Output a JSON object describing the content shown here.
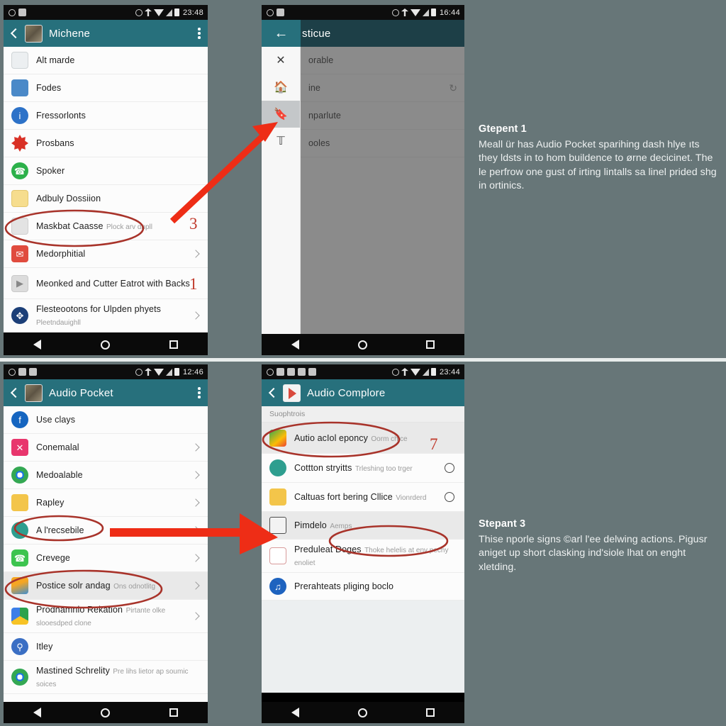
{
  "meta": {
    "background_color": "#677678",
    "accent_teal": "#27707c",
    "annotation_red": "#d6281e"
  },
  "panels": {
    "top_left": {
      "name": "top-left-phone",
      "statusbar": {
        "clock": "23:48",
        "icons": [
          "alarm-icon",
          "sd-card-icon",
          "location-icon",
          "nfc-icon",
          "wifi-icon",
          "signal-icon",
          "battery-icon"
        ]
      },
      "toolbar": {
        "title": "Michene",
        "back": "back-arrow",
        "overflow": "more-options"
      },
      "items": [
        {
          "title": "Alt marde",
          "sub": "",
          "icon": "calendar-icon",
          "trailing": ""
        },
        {
          "title": "Fodes",
          "sub": "",
          "icon": "contacts-icon",
          "trailing": ""
        },
        {
          "title": "Fressorlonts",
          "sub": "",
          "icon": "info-icon",
          "trailing": ""
        },
        {
          "title": "Prosbans",
          "sub": "",
          "icon": "alert-icon",
          "trailing": ""
        },
        {
          "title": "Spoker",
          "sub": "",
          "icon": "phone-icon",
          "trailing": ""
        },
        {
          "title": "Adbuly Dossiion",
          "sub": "",
          "icon": "person-icon",
          "trailing": ""
        },
        {
          "title": "Maskbat Caasse",
          "sub": "Plock arv dnpll",
          "icon": "media-icon",
          "trailing": ""
        },
        {
          "title": "Medorphitial",
          "sub": "",
          "icon": "mail-icon",
          "trailing": "chevron"
        },
        {
          "title": "Meonked and Cutter Eatrot with Backs",
          "sub": "",
          "icon": "video-icon",
          "trailing": ""
        },
        {
          "title": "Flesteootons for Ulpden phyets",
          "sub": "Pleetndauighll",
          "icon": "bluetooth-icon",
          "trailing": "chevron"
        }
      ]
    },
    "top_right": {
      "name": "top-right-phone",
      "statusbar": {
        "clock": "16:44"
      },
      "toolbar": {
        "title": "sticue"
      },
      "rail": [
        "close-icon",
        "home-icon",
        "bookmark-icon",
        "text-icon"
      ],
      "items": [
        {
          "title": "orable",
          "trailing": ""
        },
        {
          "title": "ine",
          "trailing": "refresh"
        },
        {
          "title": "nparlute",
          "trailing": ""
        },
        {
          "title": "ooles",
          "trailing": ""
        }
      ]
    },
    "bottom_left": {
      "name": "bottom-left-phone",
      "statusbar": {
        "clock": "12:46"
      },
      "toolbar": {
        "title": "Audio Pocket"
      },
      "items": [
        {
          "title": "Use clays",
          "sub": "",
          "icon": "facebook-icon",
          "trailing": ""
        },
        {
          "title": "Conemalal",
          "sub": "",
          "icon": "close-pink-icon",
          "trailing": "chevron"
        },
        {
          "title": "Medoalable",
          "sub": "",
          "icon": "chrome-icon",
          "trailing": "chevron"
        },
        {
          "title": "Rapley",
          "sub": "",
          "icon": "notes-icon",
          "trailing": "chevron"
        },
        {
          "title": "A l'recsebile",
          "sub": "",
          "icon": "accessibility-icon",
          "trailing": "chevron"
        },
        {
          "title": "Crevege",
          "sub": "",
          "icon": "phone-green-icon",
          "trailing": "chevron"
        },
        {
          "title": "Postice solr andag",
          "sub": "Ons odnotlitg",
          "icon": "photos-icon",
          "trailing": "chevron"
        },
        {
          "title": "Prodnamnlo Rekation",
          "sub": "Pirtante olke slooesdped clone",
          "icon": "drive-icon",
          "trailing": "chevron"
        },
        {
          "title": "Itley",
          "sub": "",
          "icon": "search-blue-icon",
          "trailing": ""
        },
        {
          "title": "Mastined Schrelity",
          "sub": "Pre lihs lietor ap soumic soices",
          "icon": "chrome-icon",
          "trailing": ""
        }
      ]
    },
    "bottom_right": {
      "name": "bottom-right-phone",
      "statusbar": {
        "clock": "23:44"
      },
      "toolbar": {
        "title": "Audio Complore"
      },
      "section_header": "Suophtrois",
      "items": [
        {
          "title": "Autio acIol eponcy",
          "sub": "Oorm chice",
          "icon": "mixed-icon",
          "trailing": ""
        },
        {
          "title": "Cottton stryitts",
          "sub": "Trleshing too trger",
          "icon": "teal-icon",
          "trailing": "radio"
        },
        {
          "title": "Caltuas fort bering Cllice",
          "sub": "Vionrderd",
          "icon": "notes-icon",
          "trailing": "radio"
        },
        {
          "title": "Pimdelo",
          "sub": "Aemps",
          "icon": "folder-icon",
          "trailing": ""
        },
        {
          "title": "Preduleat Doges",
          "sub": "Thoke helelis at env pechy enoliet",
          "icon": "calculator-icon",
          "trailing": ""
        },
        {
          "title": "Prerahteats pliging boclo",
          "sub": "",
          "icon": "globe-icon",
          "trailing": ""
        }
      ]
    }
  },
  "notes": [
    {
      "id": "note-step-1",
      "title": "Gtepent 1",
      "body": "Meall ür has Audio Pocket sparihing dash hlye ıts they ldsts in to hom buildence to ørne decicinet. The le perfrow one gust of irting lintalls sa linel prided shg in ortinics."
    },
    {
      "id": "note-step-3",
      "title": "Stepant 3",
      "body": "Thise nporle signs ©arl l'ee delwing actions. Pigusr aniget up short clasking ind'siole lhat on enght xletding."
    }
  ],
  "annotations": {
    "numbers": [
      {
        "value": "3",
        "panel": "top-left"
      },
      {
        "value": "1",
        "panel": "top-left"
      },
      {
        "value": "7",
        "panel": "bottom-right"
      }
    ],
    "arrows": [
      {
        "from": "top-left-list-item-7",
        "to": "top-right-rail"
      },
      {
        "from": "bottom-left-accessibility",
        "to": "bottom-right-folder"
      }
    ],
    "circles": [
      "top-left-maskbat-caasse",
      "bottom-left-accessibility",
      "bottom-left-postice-solr-andag",
      "bottom-right-autio-aclol-eponcy",
      "bottom-right-pimdelo"
    ]
  }
}
